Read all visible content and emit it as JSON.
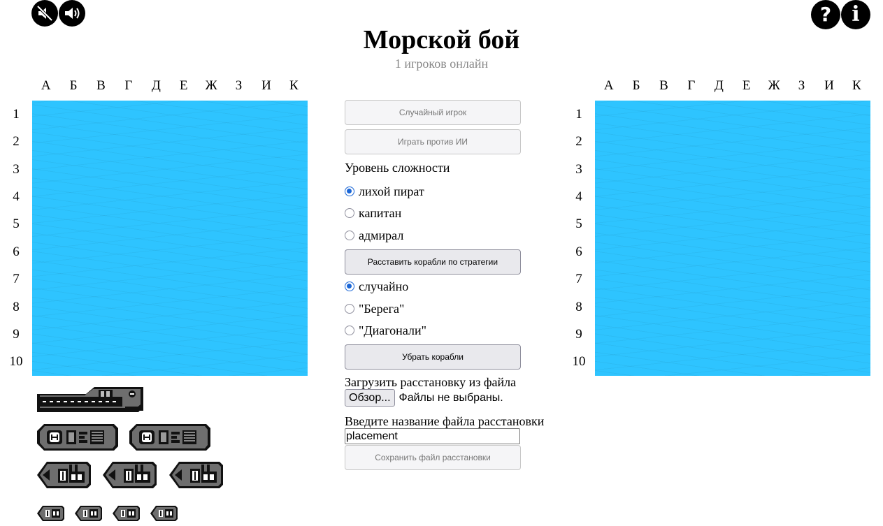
{
  "header": {
    "title": "Морской бой",
    "online": "1 игроков онлайн"
  },
  "icons": {
    "sound_off": "sound-off-icon",
    "sound_on": "sound-on-icon",
    "help": "help-icon",
    "info": "info-icon",
    "help_glyph": "?",
    "info_glyph": "i"
  },
  "board": {
    "columns": [
      "А",
      "Б",
      "В",
      "Г",
      "Д",
      "Е",
      "Ж",
      "З",
      "И",
      "К"
    ],
    "rows": [
      "1",
      "2",
      "3",
      "4",
      "5",
      "6",
      "7",
      "8",
      "9",
      "10"
    ],
    "water_color": "#2ec4ff"
  },
  "controls": {
    "random_player": "Случайный игрок",
    "play_vs_ai": "Играть против ИИ",
    "difficulty_label": "Уровень сложности",
    "difficulty_options": [
      "лихой пират",
      "капитан",
      "адмирал"
    ],
    "difficulty_selected": 0,
    "place_by_strategy": "Расставить корабли по стратегии",
    "strategy_options": [
      "случайно",
      "\"Берега\"",
      "\"Диагонали\""
    ],
    "strategy_selected": 0,
    "remove_ships": "Убрать корабли",
    "load_label": "Загрузить расстановку из файла",
    "browse_button": "Обзор...",
    "no_file": "Файлы не выбраны.",
    "filename_label": "Введите название файла расстановки",
    "filename_value": "placement",
    "save_button": "Сохранить файл расстановки"
  },
  "fleet": {
    "ships": [
      {
        "size": 4,
        "count": 1
      },
      {
        "size": 3,
        "count": 2
      },
      {
        "size": 2,
        "count": 3
      },
      {
        "size": 1,
        "count": 4
      }
    ]
  }
}
